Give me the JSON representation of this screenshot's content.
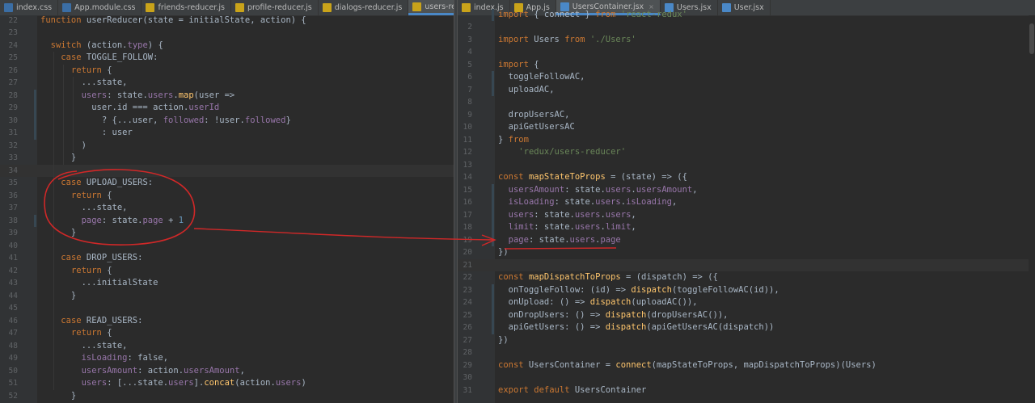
{
  "left_editor": {
    "tabs": [
      {
        "label": "index.css",
        "type": "css",
        "active": false
      },
      {
        "label": "App.module.css",
        "type": "css",
        "active": false
      },
      {
        "label": "friends-reducer.js",
        "type": "js",
        "active": false
      },
      {
        "label": "profile-reducer.js",
        "type": "js",
        "active": false
      },
      {
        "label": "dialogs-reducer.js",
        "type": "js",
        "active": false
      },
      {
        "label": "users-reducer.js",
        "type": "js",
        "active": true
      }
    ],
    "lines": [
      {
        "n": "22",
        "code": "function userReducer(state = initialState, action) {"
      },
      {
        "n": "23",
        "code": ""
      },
      {
        "n": "24",
        "code": "  switch (action.type) {"
      },
      {
        "n": "25",
        "code": "    case TOGGLE_FOLLOW:"
      },
      {
        "n": "26",
        "code": "      return {"
      },
      {
        "n": "27",
        "code": "        ...state,"
      },
      {
        "n": "28",
        "code": "        users: state.users.map(user =>"
      },
      {
        "n": "29",
        "code": "          user.id === action.userId"
      },
      {
        "n": "30",
        "code": "            ? {...user, followed: !user.followed}"
      },
      {
        "n": "31",
        "code": "            : user"
      },
      {
        "n": "32",
        "code": "        )"
      },
      {
        "n": "33",
        "code": "      }"
      },
      {
        "n": "34",
        "code": ""
      },
      {
        "n": "35",
        "code": "    case UPLOAD_USERS:"
      },
      {
        "n": "36",
        "code": "      return {"
      },
      {
        "n": "37",
        "code": "        ...state,"
      },
      {
        "n": "38",
        "code": "        page: state.page + 1"
      },
      {
        "n": "39",
        "code": "      }"
      },
      {
        "n": "40",
        "code": ""
      },
      {
        "n": "41",
        "code": "    case DROP_USERS:"
      },
      {
        "n": "42",
        "code": "      return {"
      },
      {
        "n": "43",
        "code": "        ...initialState"
      },
      {
        "n": "44",
        "code": "      }"
      },
      {
        "n": "45",
        "code": ""
      },
      {
        "n": "46",
        "code": "    case READ_USERS:"
      },
      {
        "n": "47",
        "code": "      return {"
      },
      {
        "n": "48",
        "code": "        ...state,"
      },
      {
        "n": "49",
        "code": "        isLoading: false,"
      },
      {
        "n": "50",
        "code": "        usersAmount: action.usersAmount,"
      },
      {
        "n": "51",
        "code": "        users: [...state.users].concat(action.users)"
      },
      {
        "n": "52",
        "code": "      }"
      }
    ],
    "current_line": "34"
  },
  "right_editor": {
    "tabs": [
      {
        "label": "index.js",
        "type": "js",
        "active": false
      },
      {
        "label": "App.js",
        "type": "js",
        "active": false
      },
      {
        "label": "UsersContainer.jsx",
        "type": "jsx",
        "active": true
      },
      {
        "label": "Users.jsx",
        "type": "jsx",
        "active": false
      },
      {
        "label": "User.jsx",
        "type": "jsx",
        "active": false
      }
    ],
    "lines": [
      {
        "n": "",
        "code": "import { connect } from 'react-redux'"
      },
      {
        "n": "2",
        "code": ""
      },
      {
        "n": "3",
        "code": "import Users from './Users'"
      },
      {
        "n": "4",
        "code": ""
      },
      {
        "n": "5",
        "code": "import {"
      },
      {
        "n": "6",
        "code": "  toggleFollowAC,"
      },
      {
        "n": "7",
        "code": "  uploadAC,"
      },
      {
        "n": "8",
        "code": ""
      },
      {
        "n": "9",
        "code": "  dropUsersAC,"
      },
      {
        "n": "10",
        "code": "  apiGetUsersAC"
      },
      {
        "n": "11",
        "code": "} from"
      },
      {
        "n": "12",
        "code": "    'redux/users-reducer'"
      },
      {
        "n": "13",
        "code": ""
      },
      {
        "n": "14",
        "code": "const mapStateToProps = (state) => ({"
      },
      {
        "n": "15",
        "code": "  usersAmount: state.users.usersAmount,"
      },
      {
        "n": "16",
        "code": "  isLoading: state.users.isLoading,"
      },
      {
        "n": "17",
        "code": "  users: state.users.users,"
      },
      {
        "n": "18",
        "code": "  limit: state.users.limit,"
      },
      {
        "n": "19",
        "code": "  page: state.users.page"
      },
      {
        "n": "20",
        "code": "})"
      },
      {
        "n": "21",
        "code": ""
      },
      {
        "n": "22",
        "code": "const mapDispatchToProps = (dispatch) => ({"
      },
      {
        "n": "23",
        "code": "  onToggleFollow: (id) => dispatch(toggleFollowAC(id)),"
      },
      {
        "n": "24",
        "code": "  onUpload: () => dispatch(uploadAC()),"
      },
      {
        "n": "25",
        "code": "  onDropUsers: () => dispatch(dropUsersAC()),"
      },
      {
        "n": "26",
        "code": "  apiGetUsers: () => dispatch(apiGetUsersAC(dispatch))"
      },
      {
        "n": "27",
        "code": "})"
      },
      {
        "n": "28",
        "code": ""
      },
      {
        "n": "29",
        "code": "const UsersContainer = connect(mapStateToProps, mapDispatchToProps)(Users)"
      },
      {
        "n": "30",
        "code": ""
      },
      {
        "n": "31",
        "code": "export default UsersContainer"
      }
    ],
    "current_line": "21"
  },
  "colors": {
    "background": "#2b2b2b",
    "keyword": "#cc7832",
    "function": "#ffc66d",
    "string": "#6a8759",
    "property": "#9876aa",
    "number": "#6897bb",
    "annotation": "#e03030"
  }
}
